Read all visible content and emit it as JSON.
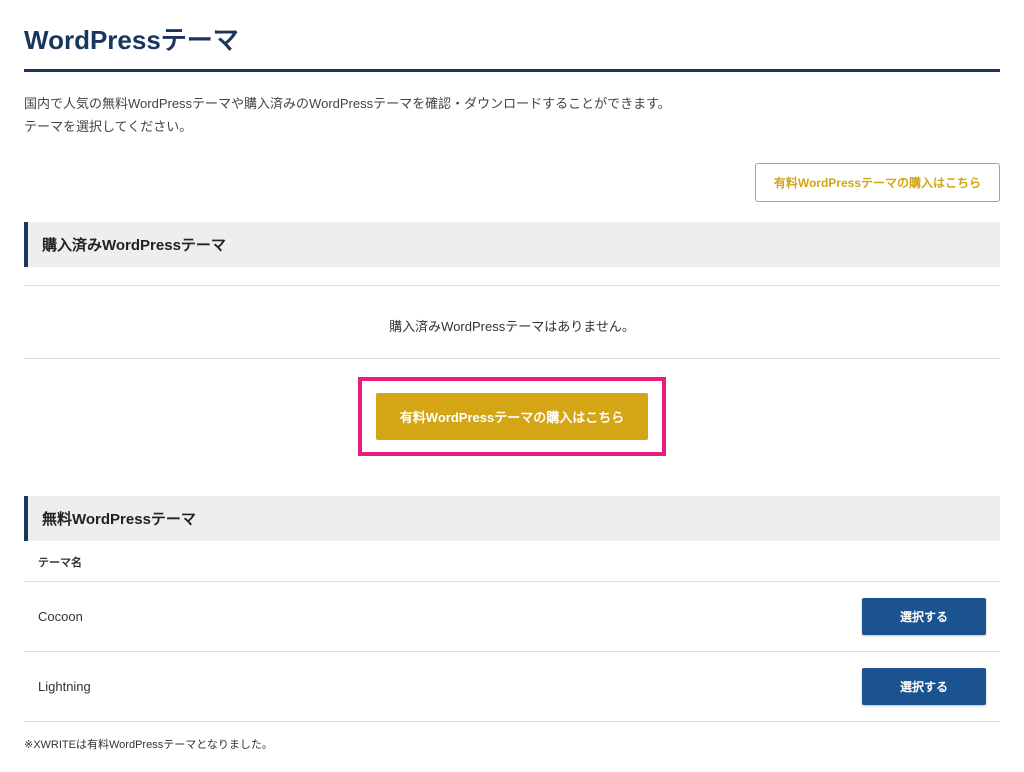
{
  "page": {
    "title": "WordPressテーマ",
    "description_line1": "国内で人気の無料WordPressテーマや購入済みのWordPressテーマを確認・ダウンロードすることができます。",
    "description_line2": "テーマを選択してください。"
  },
  "buttons": {
    "purchase_link_top": "有料WordPressテーマの購入はこちら",
    "purchase_link_main": "有料WordPressテーマの購入はこちら",
    "select": "選択する"
  },
  "sections": {
    "purchased": {
      "header": "購入済みWordPressテーマ",
      "empty_message": "購入済みWordPressテーマはありません。"
    },
    "free": {
      "header": "無料WordPressテーマ",
      "column_header": "テーマ名",
      "themes": [
        {
          "name": "Cocoon"
        },
        {
          "name": "Lightning"
        }
      ]
    }
  },
  "footnote": "※XWRITEは有料WordPressテーマとなりました。"
}
